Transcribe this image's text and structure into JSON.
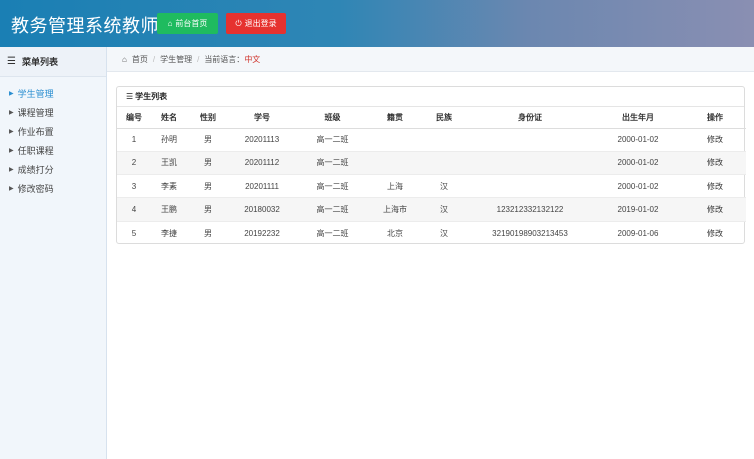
{
  "header": {
    "title": "教务管理系统教师端",
    "home_button": "前台首页",
    "logout_button": "退出登录"
  },
  "sidebar": {
    "title": "菜单列表",
    "items": [
      {
        "label": "学生管理"
      },
      {
        "label": "课程管理"
      },
      {
        "label": "作业布置"
      },
      {
        "label": "任职课程"
      },
      {
        "label": "成绩打分"
      },
      {
        "label": "修改密码"
      }
    ]
  },
  "breadcrumb": {
    "home": "首页",
    "current": "学生管理",
    "lang_label": "当前语言：",
    "lang_value": "中文"
  },
  "panel": {
    "title": "学生列表"
  },
  "table": {
    "headers": [
      "编号",
      "姓名",
      "性别",
      "学号",
      "班级",
      "籍贯",
      "民族",
      "身份证",
      "出生年月",
      "操作"
    ],
    "rows": [
      [
        "1",
        "孙明",
        "男",
        "20201113",
        "高一二班",
        "",
        "",
        "",
        "2000-01-02",
        "修改"
      ],
      [
        "2",
        "王凯",
        "男",
        "20201112",
        "高一二班",
        "",
        "",
        "",
        "2000-01-02",
        "修改"
      ],
      [
        "3",
        "李素",
        "男",
        "20201111",
        "高一二班",
        "上海",
        "汉",
        "",
        "2000-01-02",
        "修改"
      ],
      [
        "4",
        "王鹏",
        "男",
        "20180032",
        "高一二班",
        "上海市",
        "汉",
        "123212332132122",
        "2019-01-02",
        "修改"
      ],
      [
        "5",
        "李捷",
        "男",
        "20192232",
        "高一二班",
        "北京",
        "汉",
        "32190198903213453",
        "2009-01-06",
        "修改"
      ]
    ]
  },
  "colors": {
    "header_start": "#1a7fb4",
    "home_button": "#1fbb5f",
    "logout_button": "#e6322f",
    "active_link": "#2a8ed0",
    "lang_value": "#d0342c"
  }
}
